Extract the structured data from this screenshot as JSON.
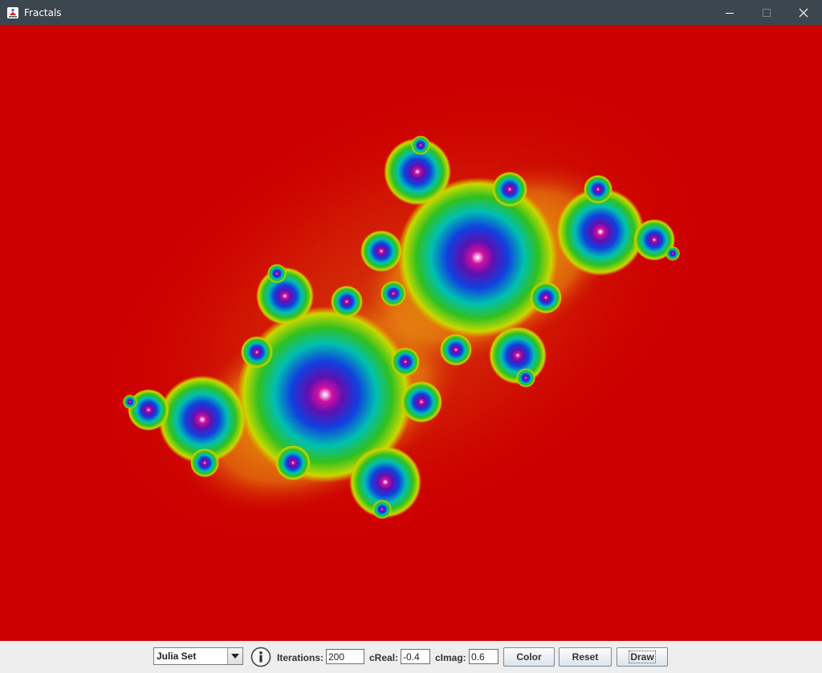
{
  "window": {
    "title": "Fractals",
    "app_icon": "java-app-icon",
    "controls": [
      "minimize-icon",
      "maximize-icon",
      "close-icon"
    ]
  },
  "canvas": {
    "background_color": "#cc0000",
    "fractal_palette": [
      "#cc0000",
      "#e87010",
      "#e8d800",
      "#30c020",
      "#00c0b0",
      "#1040e0",
      "#6010b0",
      "#d010a0"
    ]
  },
  "controls": {
    "fractal_type": {
      "selected": "Julia Set"
    },
    "info_icon": "info-icon",
    "iterations": {
      "label": "Iterations:",
      "value": "200"
    },
    "c_real": {
      "label": "cReal:",
      "value": "-0.4"
    },
    "c_imag": {
      "label": "cImag:",
      "value": "0.6"
    },
    "buttons": {
      "color": "Color",
      "reset": "Reset",
      "draw": "Draw"
    }
  }
}
